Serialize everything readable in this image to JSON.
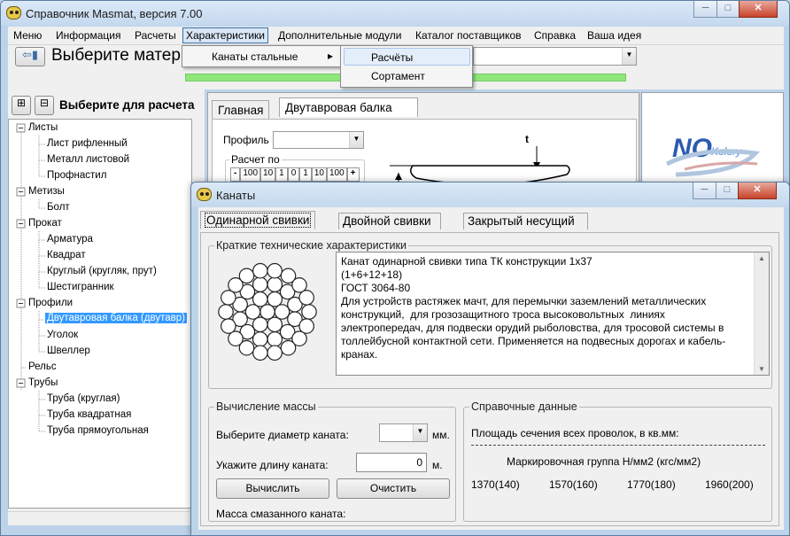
{
  "main_window": {
    "title": "Справочник Masmat, версия 7.00"
  },
  "menu": [
    "Меню",
    "Информация",
    "Расчеты",
    "Характеристики",
    "Дополнительные модули",
    "Каталог поставщиков",
    "Справка",
    "Ваша идея"
  ],
  "toolbar": {
    "select_material": "Выберите матер"
  },
  "left_panel": {
    "header": "Выберите для расчета"
  },
  "tree": {
    "listy": "Листы",
    "list_rifl": "Лист рифленный",
    "metall_list": "Металл листовой",
    "profnastil": "Профнастил",
    "metizy": "Метизы",
    "bolt": "Болт",
    "prokat": "Прокат",
    "armatura": "Арматура",
    "kvadrat": "Квадрат",
    "krugly": "Круглый (кругляк, прут)",
    "shestigr": "Шестигранник",
    "profili": "Профили",
    "dvutavr": "Двутавровая балка (двутавр)",
    "ugolok": "Уголок",
    "shveller": "Швеллер",
    "relsy": "Рельс",
    "truby": "Трубы",
    "truba_krug": "Труба (круглая)",
    "truba_kv": "Труба квадратная",
    "truba_pr": "Труба прямоугольная"
  },
  "submenu": {
    "item": "Канаты стальные",
    "arrow": "▸",
    "flyout1": "Расчёты",
    "flyout2": "Сортамент"
  },
  "bg_tabs": {
    "main": "Главная",
    "dvutavr": "Двутавровая балка"
  },
  "bg_form": {
    "profile_label": "Профиль",
    "raschet_po": "Расчет по",
    "steps": [
      "-",
      "100",
      "10",
      "1",
      "0",
      "1",
      "10",
      "100",
      "+"
    ],
    "t_label": "t"
  },
  "logo": {
    "text": "NO",
    "sub": "Kolory"
  },
  "dialog": {
    "title": "Канаты",
    "tabs": [
      "Одинарной свивки",
      "Двойной свивки",
      "Закрытый несущий"
    ],
    "brief_label": "Краткие технические характеристики",
    "description": "Канат одинарной свивки типа ТК конструкции 1х37\n(1+6+12+18)\nГОСТ 3064-80\nДля устройств растяжек мачт, для перемычки заземлений металлических конструкций,  для грозозащитного троса высоковольтных  линиях электропередач, для подвески орудий рыболовства, для тросовой системы в толлейбусной контактной сети. Применяется на подвесных дорогах и кабель-кранах.",
    "mass_group": "Вычисление массы",
    "diam_label": "Выберите диаметр каната:",
    "diam_unit": "мм.",
    "length_label": "Укажите длину каната:",
    "length_value": "0",
    "length_unit": "м.",
    "calc_button": "Вычислить",
    "clear_button": "Очистить",
    "mass_label": "Масса смазанного каната:",
    "ref_group": "Справочные данные",
    "area_label": "Площадь сечения всех проволок, в кв.мм:",
    "mark_label": "Маркировочная группа Н/мм2 (кгс/мм2)",
    "marks": [
      "1370(140)",
      "1570(160)",
      "1770(180)",
      "1960(200)"
    ]
  }
}
